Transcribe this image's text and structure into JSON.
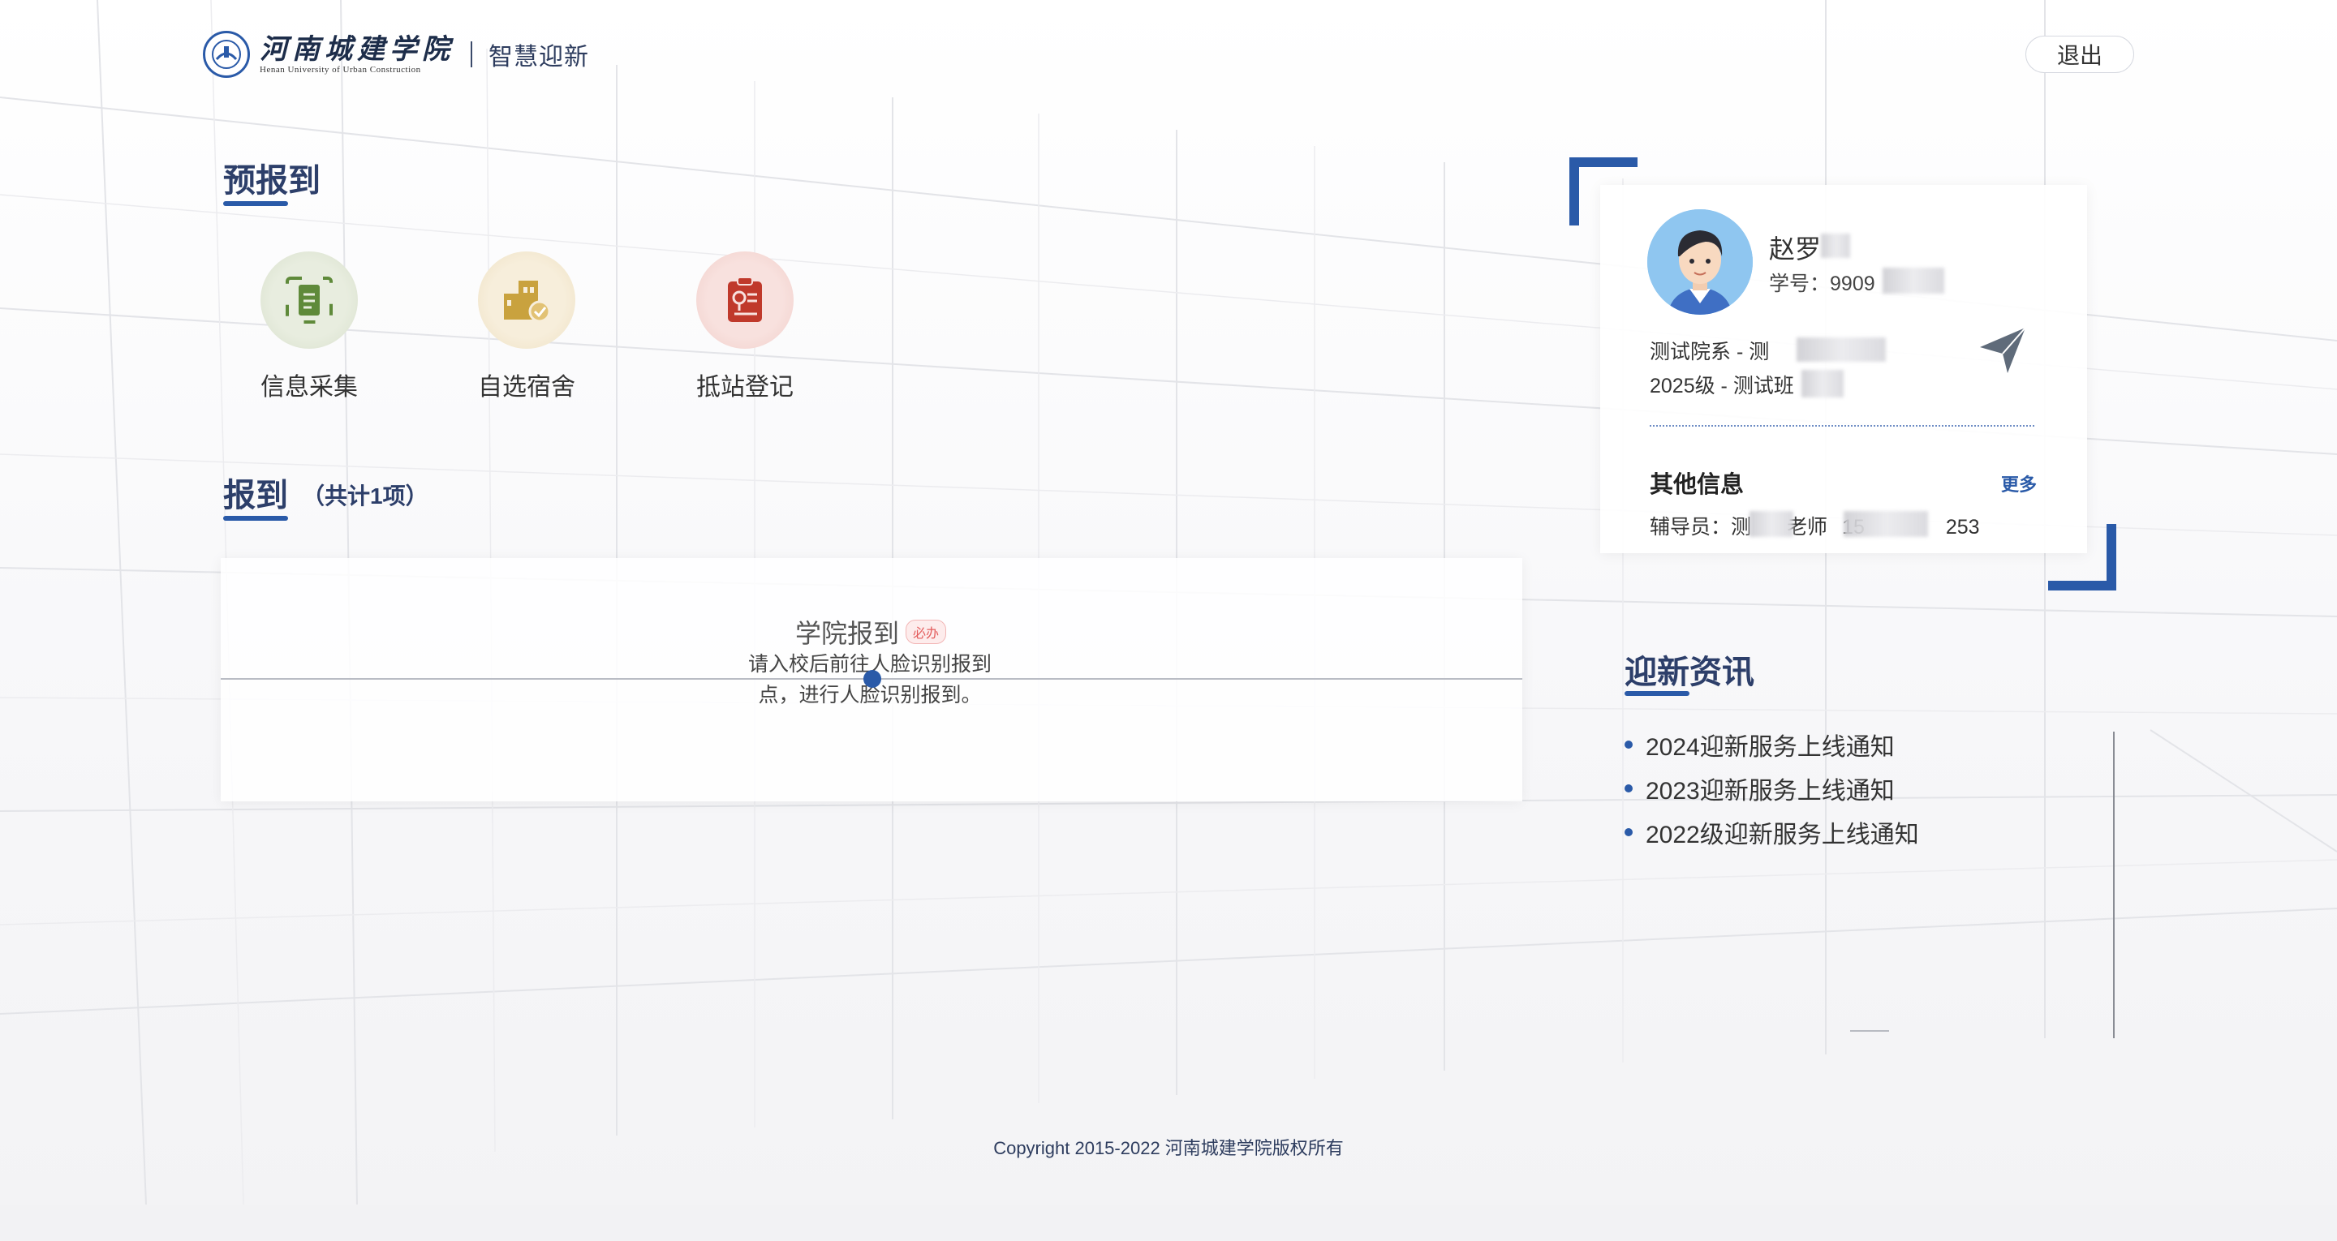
{
  "header": {
    "logo_cn": "河南城建学院",
    "logo_en": "Henan University of Urban Construction",
    "system_name": "智慧迎新",
    "logout_label": "退出"
  },
  "pre_register": {
    "title": "预报到",
    "items": [
      {
        "label": "信息采集",
        "icon": "document-icon",
        "color": "#5f8a3a"
      },
      {
        "label": "自选宿舍",
        "icon": "building-icon",
        "color": "#c9a23e"
      },
      {
        "label": "抵站登记",
        "icon": "clipboard-icon",
        "color": "#c0392b"
      }
    ]
  },
  "register": {
    "title": "报到",
    "count": "（共计1项）",
    "step": {
      "title": "学院报到",
      "badge": "必办",
      "desc_line1": "请入校后前往人脸识别报到",
      "desc_line2": "点，进行人脸识别报到。"
    }
  },
  "profile": {
    "name": "赵罗",
    "student_id_label": "学号：",
    "student_id": "9909",
    "dept": "测试院系 - 测",
    "class": "2025级 - 测试班",
    "other_info_label": "其他信息",
    "more_label": "更多",
    "counselor_label": "辅导员：",
    "counselor_name": "测",
    "counselor_suffix": "老师",
    "counselor_phone_head": "15",
    "counselor_phone_tail": "253"
  },
  "news": {
    "title": "迎新资讯",
    "items": [
      "2024迎新服务上线通知",
      "2023迎新服务上线通知",
      "2022级迎新服务上线通知"
    ]
  },
  "footer": {
    "copyright": "Copyright 2015-2022 河南城建学院版权所有"
  },
  "colors": {
    "accent": "#2a5aa8",
    "title": "#2d3f6a"
  }
}
